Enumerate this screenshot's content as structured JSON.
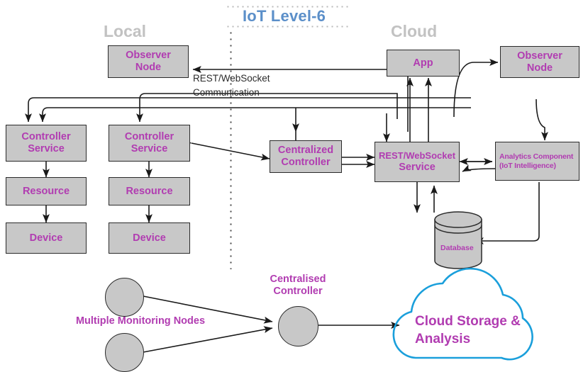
{
  "title": "IoT Level-6",
  "zones": {
    "local": "Local",
    "cloud": "Cloud"
  },
  "annotations": {
    "communication_line1": "REST/WebSocket",
    "communication_line2": "Communication"
  },
  "local_nodes": {
    "observer_node": {
      "line1": "Observer",
      "line2": "Node"
    },
    "column1": {
      "controller_service": {
        "line1": "Controller",
        "line2": "Service"
      },
      "resource": "Resource",
      "device": "Device"
    },
    "column2": {
      "controller_service": {
        "line1": "Controller",
        "line2": "Service"
      },
      "resource": "Resource",
      "device": "Device"
    },
    "centralized_controller": {
      "line1": "Centralized",
      "line2": "Controller"
    }
  },
  "cloud_nodes": {
    "app": "App",
    "observer_node": {
      "line1": "Observer",
      "line2": "Node"
    },
    "rest_websocket_service": {
      "line1": "REST/WebSocket",
      "line2": "Service"
    },
    "analytics_component": {
      "line1": "Analytics Component",
      "line2": "(IoT Intelligence)"
    },
    "database": "Database"
  },
  "bottom": {
    "monitoring_nodes_label": "Multiple Monitoring Nodes",
    "centralised_controller": {
      "line1": "Centralised",
      "line2": "Controller"
    },
    "cloud_storage": {
      "line1": "Cloud Storage",
      "line2": "& Analysis"
    }
  },
  "colors": {
    "node_fill": "#c8c8c8",
    "node_border": "#2a2a2a",
    "node_text": "#b13cb1",
    "title": "#5b8fc9",
    "zone_header": "#c2c2c2",
    "cloud_outline": "#1a9fdb",
    "arrow": "#1a1a1a"
  }
}
